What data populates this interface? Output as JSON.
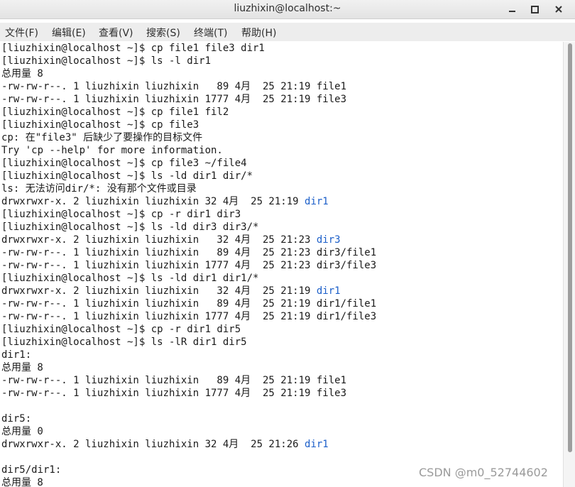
{
  "window": {
    "title": "liuzhixin@localhost:~",
    "controls": [
      "minimize-icon",
      "maximize-icon",
      "close-icon"
    ]
  },
  "menubar": {
    "items": [
      "文件(F)",
      "编辑(E)",
      "查看(V)",
      "搜索(S)",
      "终端(T)",
      "帮助(H)"
    ]
  },
  "terminal": {
    "lines": [
      [
        {
          "t": "[liuzhixin@localhost ~]$ cp file1 file3 dir1"
        }
      ],
      [
        {
          "t": "[liuzhixin@localhost ~]$ ls -l dir1"
        }
      ],
      [
        {
          "t": "总用量 8"
        }
      ],
      [
        {
          "t": "-rw-rw-r--. 1 liuzhixin liuzhixin   89 4月  25 21:19 file1"
        }
      ],
      [
        {
          "t": "-rw-rw-r--. 1 liuzhixin liuzhixin 1777 4月  25 21:19 file3"
        }
      ],
      [
        {
          "t": "[liuzhixin@localhost ~]$ cp file1 fil2"
        }
      ],
      [
        {
          "t": "[liuzhixin@localhost ~]$ cp file3"
        }
      ],
      [
        {
          "t": "cp: 在\"file3\" 后缺少了要操作的目标文件"
        }
      ],
      [
        {
          "t": "Try 'cp --help' for more information."
        }
      ],
      [
        {
          "t": "[liuzhixin@localhost ~]$ cp file3 ~/file4"
        }
      ],
      [
        {
          "t": "[liuzhixin@localhost ~]$ ls -ld dir1 dir/*"
        }
      ],
      [
        {
          "t": "ls: 无法访问dir/*: 没有那个文件或目录"
        }
      ],
      [
        {
          "t": "drwxrwxr-x. 2 liuzhixin liuzhixin 32 4月  25 21:19 "
        },
        {
          "t": "dir1",
          "c": "blue"
        }
      ],
      [
        {
          "t": "[liuzhixin@localhost ~]$ cp -r dir1 dir3"
        }
      ],
      [
        {
          "t": "[liuzhixin@localhost ~]$ ls -ld dir3 dir3/*"
        }
      ],
      [
        {
          "t": "drwxrwxr-x. 2 liuzhixin liuzhixin   32 4月  25 21:23 "
        },
        {
          "t": "dir3",
          "c": "blue"
        }
      ],
      [
        {
          "t": "-rw-rw-r--. 1 liuzhixin liuzhixin   89 4月  25 21:23 dir3/file1"
        }
      ],
      [
        {
          "t": "-rw-rw-r--. 1 liuzhixin liuzhixin 1777 4月  25 21:23 dir3/file3"
        }
      ],
      [
        {
          "t": "[liuzhixin@localhost ~]$ ls -ld dir1 dir1/*"
        }
      ],
      [
        {
          "t": "drwxrwxr-x. 2 liuzhixin liuzhixin   32 4月  25 21:19 "
        },
        {
          "t": "dir1",
          "c": "blue"
        }
      ],
      [
        {
          "t": "-rw-rw-r--. 1 liuzhixin liuzhixin   89 4月  25 21:19 dir1/file1"
        }
      ],
      [
        {
          "t": "-rw-rw-r--. 1 liuzhixin liuzhixin 1777 4月  25 21:19 dir1/file3"
        }
      ],
      [
        {
          "t": "[liuzhixin@localhost ~]$ cp -r dir1 dir5"
        }
      ],
      [
        {
          "t": "[liuzhixin@localhost ~]$ ls -lR dir1 dir5"
        }
      ],
      [
        {
          "t": "dir1:"
        }
      ],
      [
        {
          "t": "总用量 8"
        }
      ],
      [
        {
          "t": "-rw-rw-r--. 1 liuzhixin liuzhixin   89 4月  25 21:19 file1"
        }
      ],
      [
        {
          "t": "-rw-rw-r--. 1 liuzhixin liuzhixin 1777 4月  25 21:19 file3"
        }
      ],
      [
        {
          "t": ""
        }
      ],
      [
        {
          "t": "dir5:"
        }
      ],
      [
        {
          "t": "总用量 0"
        }
      ],
      [
        {
          "t": "drwxrwxr-x. 2 liuzhixin liuzhixin 32 4月  25 21:26 "
        },
        {
          "t": "dir1",
          "c": "blue"
        }
      ],
      [
        {
          "t": ""
        }
      ],
      [
        {
          "t": "dir5/dir1:"
        }
      ],
      [
        {
          "t": "总用量 8"
        }
      ]
    ]
  },
  "watermark": "CSDN @m0_52744602"
}
